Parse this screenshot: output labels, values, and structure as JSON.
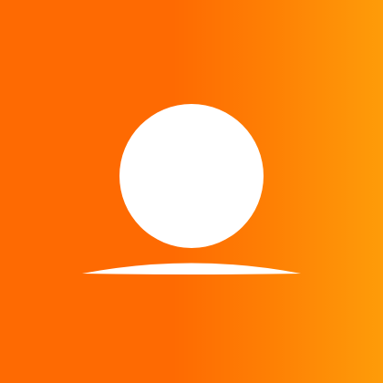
{
  "colors": {
    "gradient_start": "#fe6a02",
    "gradient_mid": "#fe7f04",
    "gradient_end": "#fe9c09",
    "mark": "#ffffff"
  },
  "icon": {
    "name": "sunrise-logo-icon",
    "parts": [
      "sun-disc",
      "horizon-line"
    ]
  }
}
